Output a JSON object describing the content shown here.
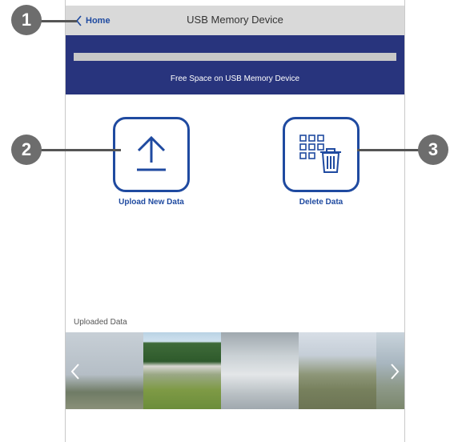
{
  "header": {
    "back_label": "Home",
    "title": "USB Memory Device"
  },
  "storage": {
    "label": "Free Space on USB Memory Device",
    "used_fraction": 0.0
  },
  "actions": {
    "upload_label": "Upload New Data",
    "delete_label": "Delete Data"
  },
  "uploaded": {
    "label": "Uploaded Data",
    "thumbnails": [
      "thumbnail",
      "thumbnail",
      "thumbnail",
      "thumbnail",
      "thumbnail"
    ]
  },
  "callouts": [
    "1",
    "2",
    "3"
  ],
  "colors": {
    "accent": "#1f4aa0",
    "header_band": "#28347d",
    "topbar": "#d9d9d9",
    "callout": "#6d6d6d"
  },
  "icons": {
    "back": "chevron-left-icon",
    "upload": "upload-arrow-icon",
    "delete": "grid-trash-icon",
    "prev": "chevron-left-icon",
    "next": "chevron-right-icon"
  }
}
